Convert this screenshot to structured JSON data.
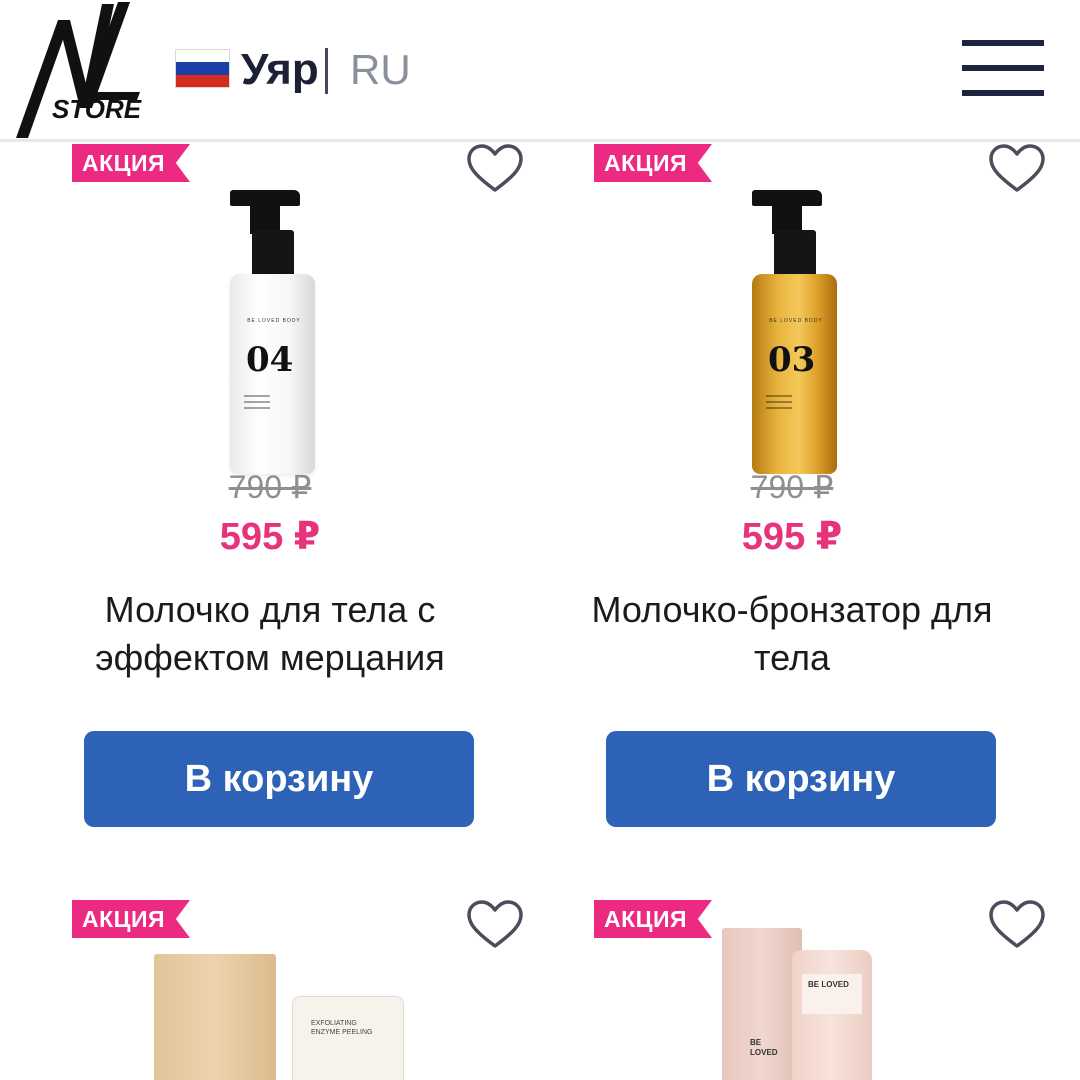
{
  "header": {
    "city": "Уяр",
    "language": "RU",
    "logo_text": "NL STORE"
  },
  "colors": {
    "badge": "#ec2a82",
    "price_sale": "#e8337c",
    "cart_button": "#2d62b7",
    "header_text": "#1b2035"
  },
  "products": [
    {
      "badge": "АКЦИЯ",
      "old_price": "790 ₽",
      "new_price": "595 ₽",
      "title": "Молочко для тела с эффектом мерцания",
      "cart_label": "В корзину",
      "label_number": "04"
    },
    {
      "badge": "АКЦИЯ",
      "old_price": "790 ₽",
      "new_price": "595 ₽",
      "title": "Молочко-бронзатор для тела",
      "cart_label": "В корзину",
      "label_number": "03"
    },
    {
      "badge": "АКЦИЯ"
    },
    {
      "badge": "АКЦИЯ"
    }
  ]
}
